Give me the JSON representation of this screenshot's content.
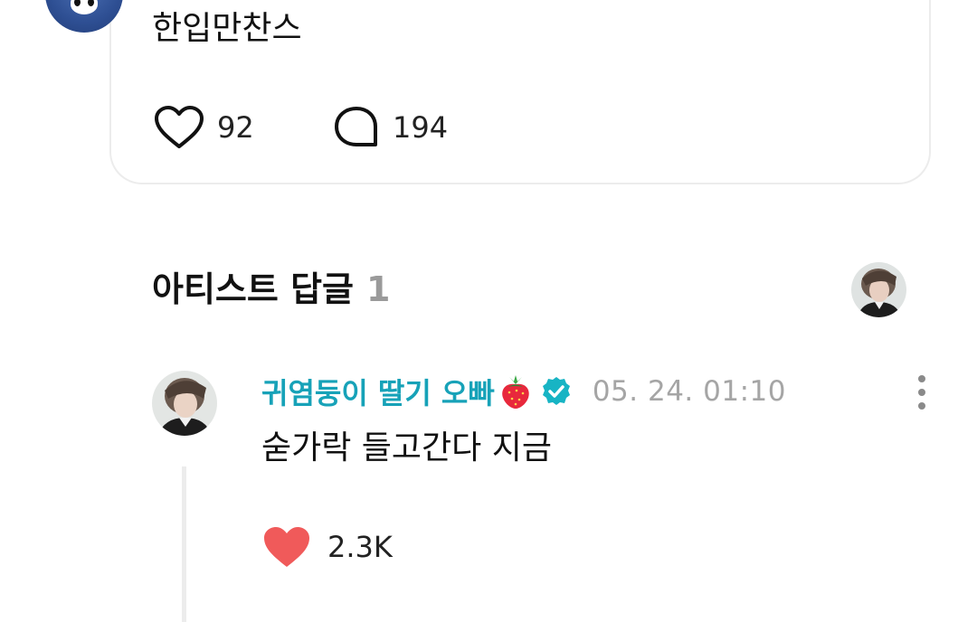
{
  "post": {
    "text": "한입만찬스",
    "likes": "92",
    "comments": "194"
  },
  "artist_section": {
    "title": "아티스트 답글",
    "count": "1"
  },
  "reply": {
    "author": "귀염둥이 딸기 오빠",
    "author_emoji": "strawberry-icon",
    "verified": "verified-badge-icon",
    "time": "05. 24. 01:10",
    "text": "숟가락 들고간다 지금",
    "likes": "2.3K"
  },
  "colors": {
    "accent": "#17a2b8",
    "heart_filled": "#f05a5a",
    "muted": "#a5a5a5",
    "divider": "#ececec"
  }
}
